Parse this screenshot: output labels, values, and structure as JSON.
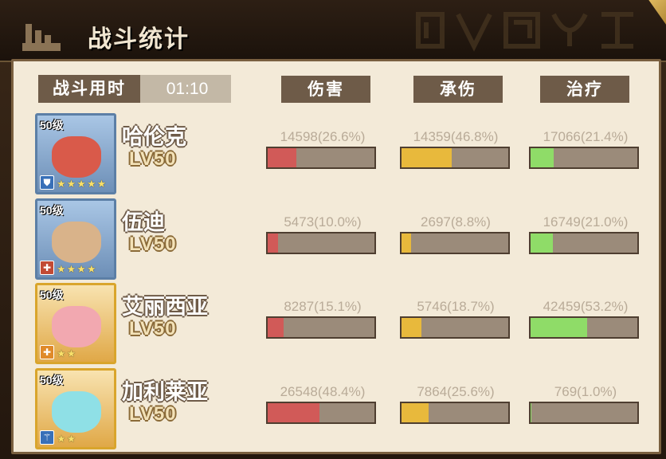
{
  "header": {
    "title": "战斗统计"
  },
  "battle_time": {
    "label": "战斗用时",
    "value": "01:10"
  },
  "columns": {
    "damage": "伤害",
    "taken": "承伤",
    "heal": "治疗"
  },
  "heroes": [
    {
      "name": "哈伦克",
      "level": "LV50",
      "badge": "50级",
      "stars": "★★★★★",
      "damage": {
        "text": "14598(26.6%)",
        "pct": 26.6
      },
      "taken": {
        "text": "14359(46.8%)",
        "pct": 46.8
      },
      "heal": {
        "text": "17066(21.4%)",
        "pct": 21.4
      }
    },
    {
      "name": "伍迪",
      "level": "LV50",
      "badge": "50级",
      "stars": "★★★★",
      "damage": {
        "text": "5473(10.0%)",
        "pct": 10.0
      },
      "taken": {
        "text": "2697(8.8%)",
        "pct": 8.8
      },
      "heal": {
        "text": "16749(21.0%)",
        "pct": 21.0
      }
    },
    {
      "name": "艾丽西亚",
      "level": "LV50",
      "badge": "50级",
      "stars": "★★",
      "damage": {
        "text": "8287(15.1%)",
        "pct": 15.1
      },
      "taken": {
        "text": "5746(18.7%)",
        "pct": 18.7
      },
      "heal": {
        "text": "42459(53.2%)",
        "pct": 53.2
      }
    },
    {
      "name": "加利莱亚",
      "level": "LV50",
      "badge": "50级",
      "stars": "★★",
      "damage": {
        "text": "26548(48.4%)",
        "pct": 48.4
      },
      "taken": {
        "text": "7864(25.6%)",
        "pct": 25.6
      },
      "heal": {
        "text": "769(1.0%)",
        "pct": 1.0
      }
    }
  ],
  "colors": {
    "damage": "#d15a58",
    "taken": "#e8b93c",
    "heal": "#8fdc68",
    "header_bg": "#6e5b48"
  }
}
